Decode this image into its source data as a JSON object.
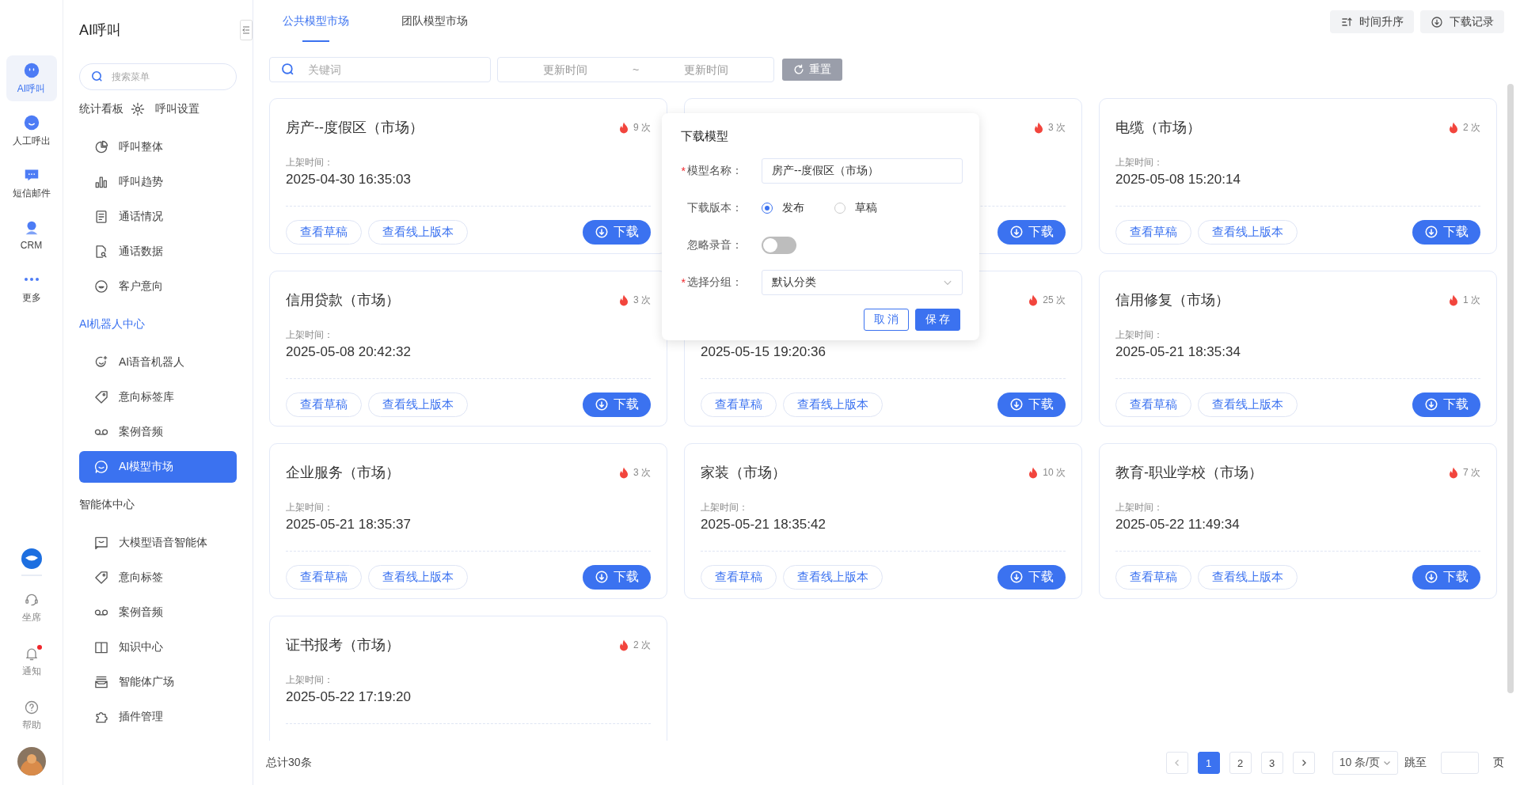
{
  "rail": {
    "items": [
      {
        "label": "AI呼叫",
        "selected": true
      },
      {
        "label": "人工呼出",
        "selected": false
      },
      {
        "label": "短信邮件",
        "selected": false
      },
      {
        "label": "CRM",
        "selected": false
      },
      {
        "label": "更多",
        "selected": false
      }
    ],
    "bottom": [
      {
        "label": "坐席",
        "badge": false
      },
      {
        "label": "通知",
        "badge": true
      },
      {
        "label": "帮助",
        "badge": false
      }
    ]
  },
  "sidebar": {
    "title": "AI呼叫",
    "search": {
      "placeholder": "搜索菜单"
    },
    "sections": [
      {
        "title": "统计看板",
        "active": false,
        "header_item": {
          "label": "呼叫设置",
          "selected": false
        },
        "items": [
          {
            "label": "呼叫整体",
            "selected": false
          },
          {
            "label": "呼叫趋势",
            "selected": false
          },
          {
            "label": "通话情况",
            "selected": false
          },
          {
            "label": "通话数据",
            "selected": false
          },
          {
            "label": "客户意向",
            "selected": false
          }
        ]
      },
      {
        "title": "AI机器人中心",
        "active": true,
        "items": [
          {
            "label": "AI语音机器人",
            "selected": false
          },
          {
            "label": "意向标签库",
            "selected": false
          },
          {
            "label": "案例音频",
            "selected": false
          },
          {
            "label": "AI模型市场",
            "selected": true
          }
        ]
      },
      {
        "title": "智能体中心",
        "active": false,
        "items": [
          {
            "label": "大模型语音智能体",
            "selected": false
          },
          {
            "label": "意向标签",
            "selected": false
          },
          {
            "label": "案例音频",
            "selected": false
          },
          {
            "label": "知识中心",
            "selected": false
          },
          {
            "label": "智能体广场",
            "selected": false
          },
          {
            "label": "插件管理",
            "selected": false
          }
        ]
      }
    ]
  },
  "tabs": [
    {
      "label": "公共模型市场",
      "selected": true
    },
    {
      "label": "团队模型市场",
      "selected": false
    }
  ],
  "toolbar": {
    "buttons": [
      "时间升序",
      "下载记录"
    ]
  },
  "filters": {
    "keyword": {
      "placeholder": "关键词"
    },
    "date_range": {
      "start_placeholder": "更新时间",
      "separator": "~",
      "end_placeholder": "更新时间"
    },
    "reset": "重置"
  },
  "cards": [
    {
      "title": "房产--度假区（市场）",
      "count": "9 次",
      "listed_label": "上架时间：",
      "listed_at": "2025-04-30 16:35:03",
      "actions": [
        "查看草稿",
        "查看线上版本"
      ],
      "download": "下载"
    },
    {
      "count": "3 次",
      "download": "下载"
    },
    {
      "title": "电缆（市场）",
      "count": "2 次",
      "listed_label": "上架时间：",
      "listed_at": "2025-05-08 15:20:14",
      "actions": [
        "查看草稿",
        "查看线上版本"
      ],
      "download": "下载"
    },
    {
      "title": "信用贷款（市场）",
      "count": "3 次",
      "listed_label": "上架时间：",
      "listed_at": "2025-05-08 20:42:32",
      "actions": [
        "查看草稿",
        "查看线上版本"
      ],
      "download": "下载"
    },
    {
      "count": "25 次",
      "listed_at": "2025-05-15 19:20:36",
      "actions": [
        "查看草稿",
        "查看线上版本"
      ],
      "download": "下载"
    },
    {
      "title": "信用修复（市场）",
      "count": "1 次",
      "listed_label": "上架时间：",
      "listed_at": "2025-05-21 18:35:34",
      "actions": [
        "查看草稿",
        "查看线上版本"
      ],
      "download": "下载"
    },
    {
      "title": "企业服务（市场）",
      "count": "3 次",
      "listed_label": "上架时间：",
      "listed_at": "2025-05-21 18:35:37",
      "actions": [
        "查看草稿",
        "查看线上版本"
      ],
      "download": "下载"
    },
    {
      "title": "家装（市场）",
      "count": "10 次",
      "listed_label": "上架时间：",
      "listed_at": "2025-05-21 18:35:42",
      "actions": [
        "查看草稿",
        "查看线上版本"
      ],
      "download": "下载"
    },
    {
      "title": "教育-职业学校（市场）",
      "count": "7 次",
      "listed_label": "上架时间：",
      "listed_at": "2025-05-22 11:49:34",
      "actions": [
        "查看草稿",
        "查看线上版本"
      ],
      "download": "下载"
    },
    {
      "title": "证书报考（市场）",
      "count": "2 次",
      "listed_label": "上架时间：",
      "listed_at": "2025-05-22 17:19:20"
    }
  ],
  "dialog": {
    "title": "下载模型",
    "fields": [
      {
        "kind": "text",
        "label": "模型名称：",
        "required_mark": "*",
        "value": "房产--度假区（市场）"
      },
      {
        "kind": "radio",
        "label": "下载版本：",
        "options": [
          {
            "label": "发布",
            "selected": true
          },
          {
            "label": "草稿",
            "selected": false
          }
        ]
      },
      {
        "kind": "switch",
        "label": "忽略录音：",
        "on": false
      },
      {
        "kind": "select",
        "label": "选择分组：",
        "required_mark": "*",
        "value": "默认分类"
      }
    ],
    "buttons": [
      {
        "label": "取 消",
        "primary": false
      },
      {
        "label": "保 存",
        "primary": true
      }
    ]
  },
  "footer": {
    "total": "总计30条",
    "pages": [
      {
        "label": "1",
        "selected": true
      },
      {
        "label": "2",
        "selected": false
      },
      {
        "label": "3",
        "selected": false
      }
    ],
    "page_size": "10 条/页",
    "jump_label": "跳至",
    "jump_suffix": "页"
  }
}
